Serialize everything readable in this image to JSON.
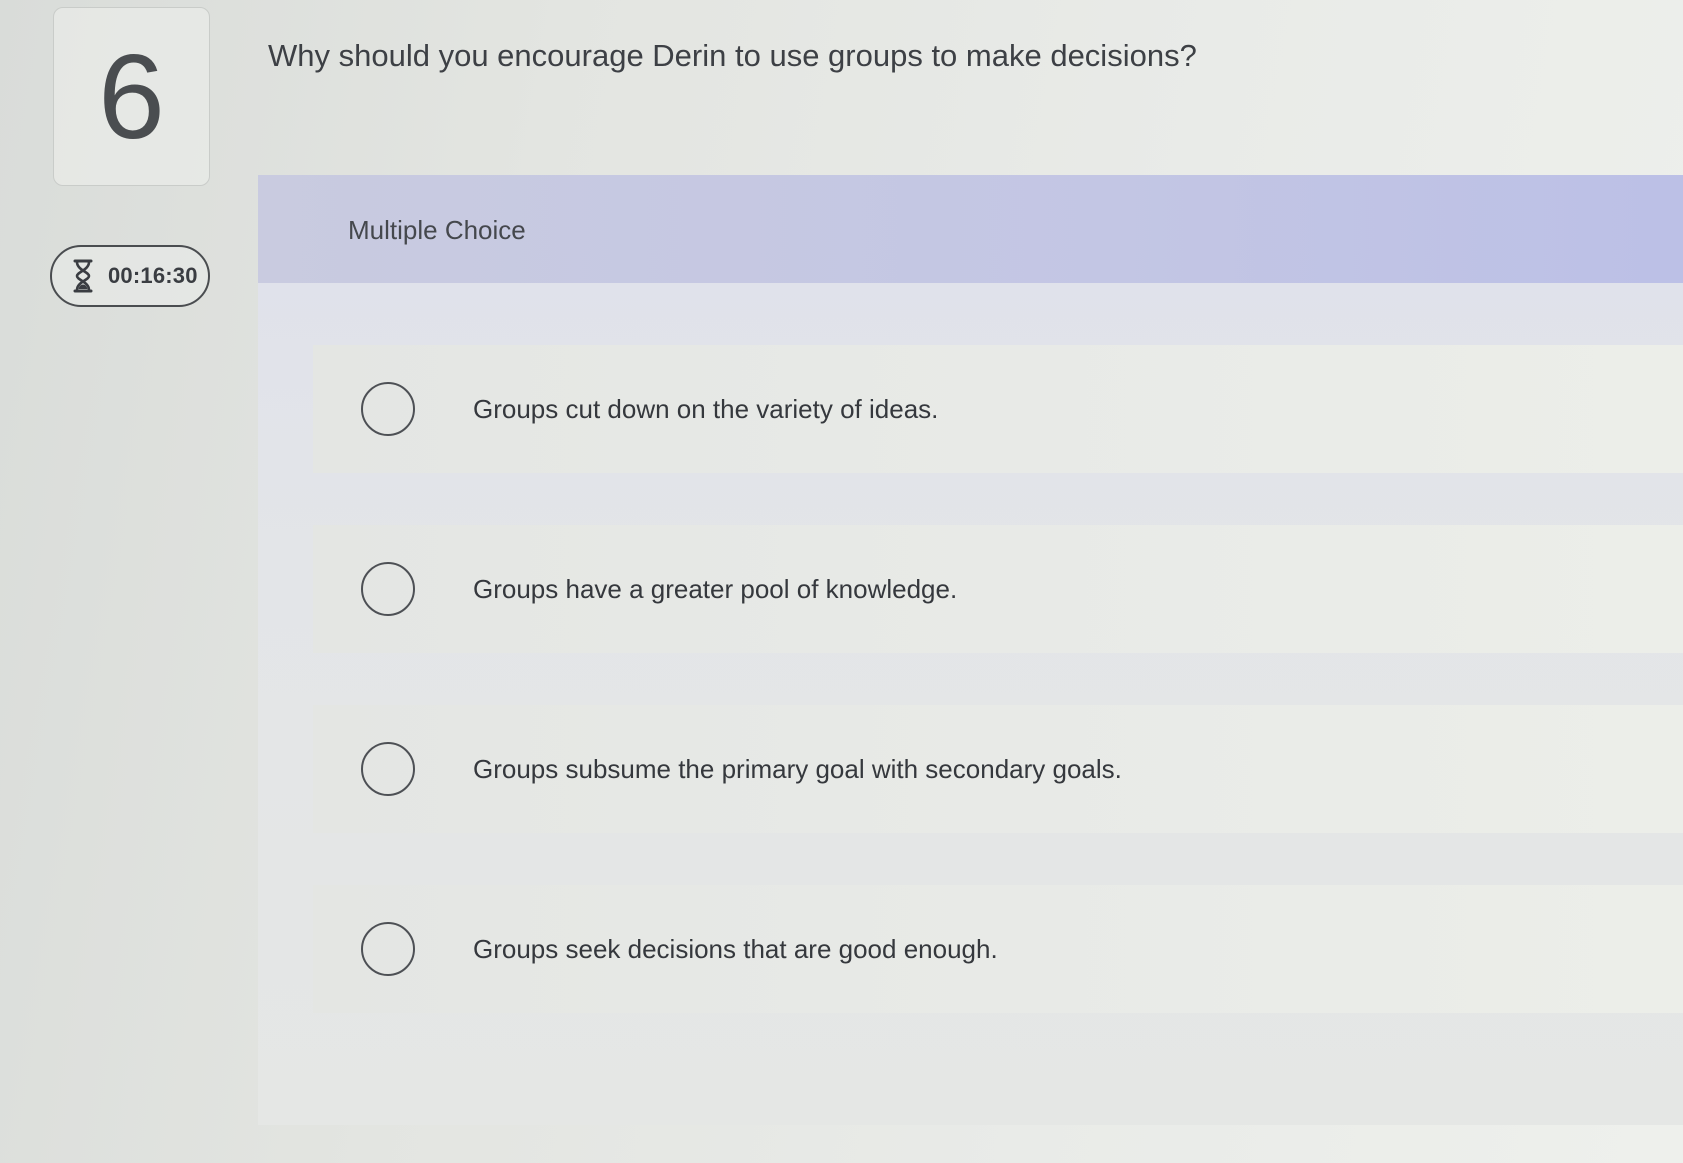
{
  "question": {
    "number": "6",
    "prompt": "Why should you encourage Derin to use groups to make decisions?"
  },
  "timer": {
    "icon": "hourglass-icon",
    "value": "00:16:30"
  },
  "panel": {
    "type_label": "Multiple Choice",
    "options": [
      {
        "label": "Groups cut down on the variety of ideas.",
        "selected": false
      },
      {
        "label": "Groups have a greater pool of knowledge.",
        "selected": false
      },
      {
        "label": "Groups subsume the primary goal with secondary goals.",
        "selected": false
      },
      {
        "label": "Groups seek decisions that are good enough.",
        "selected": false
      }
    ]
  },
  "colors": {
    "header_band": "#c3c6e4",
    "text": "#3a3d42",
    "border": "#4a4d50"
  }
}
